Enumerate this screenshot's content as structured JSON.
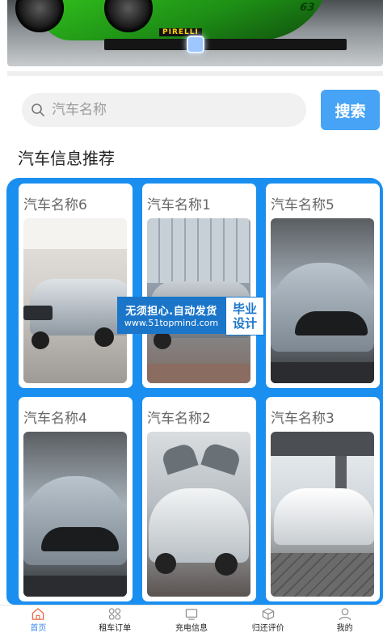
{
  "banner": {
    "brand_text": "PIRELLI",
    "badge_text": "63"
  },
  "search": {
    "placeholder": "汽车名称",
    "button_label": "搜索"
  },
  "section": {
    "title": "汽车信息推荐"
  },
  "cars": [
    {
      "title": "汽车名称6",
      "photo": "suv-showroom"
    },
    {
      "title": "汽车名称1",
      "photo": "suv-street"
    },
    {
      "title": "汽车名称5",
      "photo": "tesla-model-s"
    },
    {
      "title": "汽车名称4",
      "photo": "tesla-model-s"
    },
    {
      "title": "汽车名称2",
      "photo": "tesla-model-x"
    },
    {
      "title": "汽车名称3",
      "photo": "white-sedan"
    }
  ],
  "watermark": {
    "line1": "无须担心.自动发货",
    "line2": "www.51topmind.com",
    "tag_line1": "毕业",
    "tag_line2": "设计"
  },
  "tabbar": {
    "items": [
      {
        "label": "首页",
        "icon": "home-icon",
        "active": true
      },
      {
        "label": "租车订单",
        "icon": "grid-icon",
        "active": false
      },
      {
        "label": "充电信息",
        "icon": "screen-icon",
        "active": false
      },
      {
        "label": "归还评价",
        "icon": "box-icon",
        "active": false
      },
      {
        "label": "我的",
        "icon": "user-icon",
        "active": false
      }
    ]
  },
  "colors": {
    "accent": "#47a3f5",
    "panel": "#1a8ff0",
    "active_tab": "#3c8ce7",
    "watermark": "#1b76c9"
  }
}
